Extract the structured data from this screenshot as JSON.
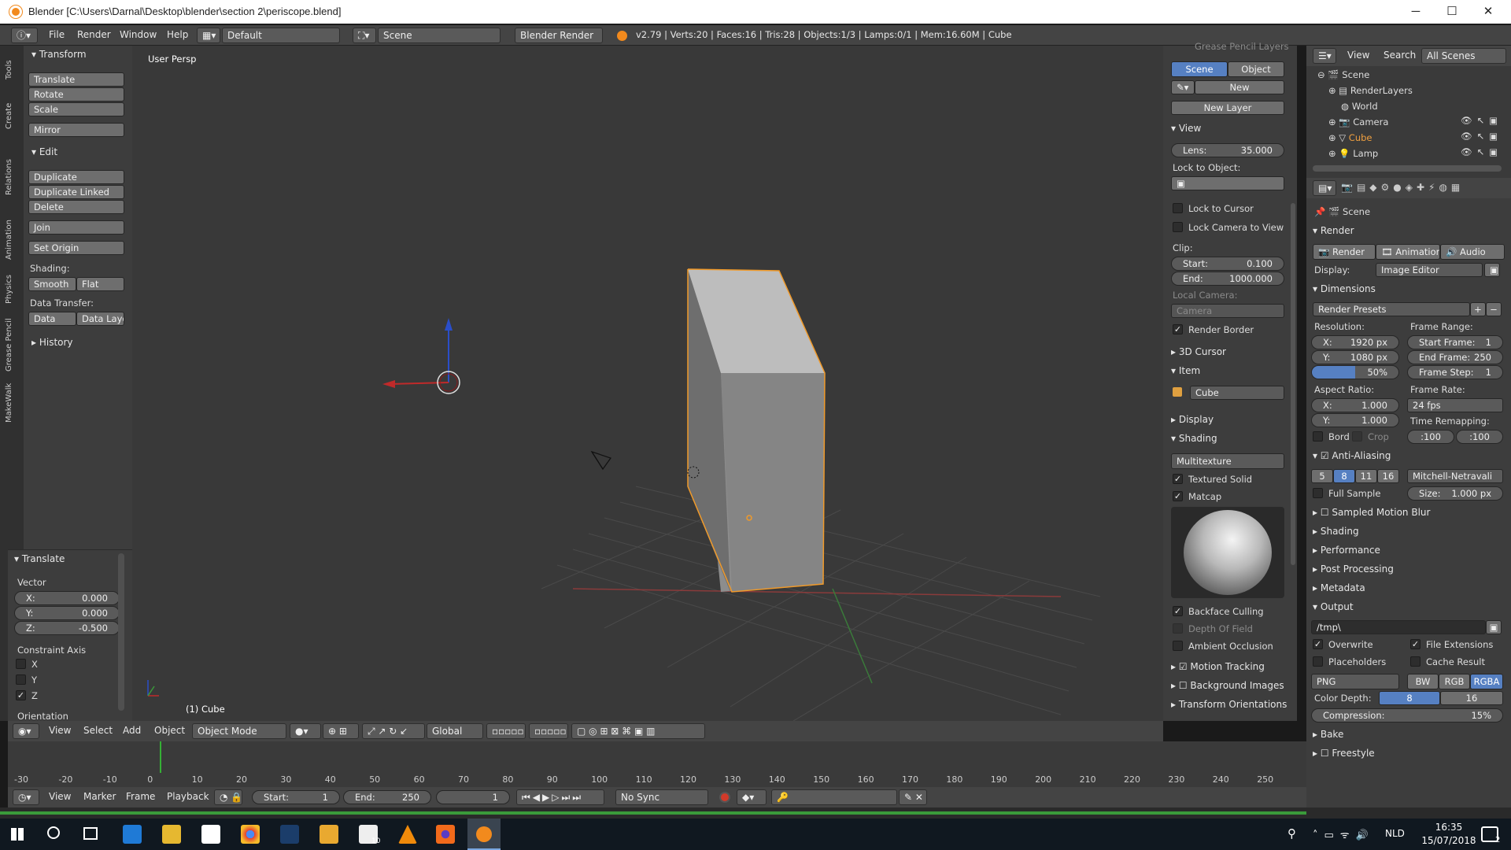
{
  "window": {
    "title": "Blender [C:\\Users\\Darnal\\Desktop\\blender\\section 2\\periscope.blend]",
    "minimize": "─",
    "maximize": "☐",
    "close": "✕"
  },
  "infobar": {
    "menus": [
      "File",
      "Render",
      "Window",
      "Help"
    ],
    "layout": "Default",
    "scene": "Scene",
    "engine": "Blender Render",
    "stats": "v2.79 | Verts:20 | Faces:16 | Tris:28 | Objects:1/3 | Lamps:0/1 | Mem:16.60M | Cube"
  },
  "tools": {
    "tabs": [
      "Tools",
      "Create",
      "Relations",
      "Animation",
      "Physics",
      "Grease Pencil",
      "MakeWalk"
    ],
    "transform_header": "Transform",
    "translate": "Translate",
    "rotate": "Rotate",
    "scale": "Scale",
    "mirror": "Mirror",
    "edit_header": "Edit",
    "duplicate": "Duplicate",
    "duplicate_linked": "Duplicate Linked",
    "delete": "Delete",
    "join": "Join",
    "set_origin": "Set Origin",
    "shading_label": "Shading:",
    "smooth": "Smooth",
    "flat": "Flat",
    "data_transfer_label": "Data Transfer:",
    "data": "Data",
    "data_layout": "Data Layo",
    "history": "History"
  },
  "operator": {
    "header": "Translate",
    "vector_label": "Vector",
    "x_label": "X:",
    "x": "0.000",
    "y_label": "Y:",
    "y": "0.000",
    "z_label": "Z:",
    "z": "-0.500",
    "constraint_label": "Constraint Axis",
    "ax_x": "X",
    "ax_y": "Y",
    "ax_z": "Z",
    "orientation": "Orientation"
  },
  "viewport": {
    "label": "User Persp",
    "object_label": "(1) Cube"
  },
  "view3d_header": {
    "menus": [
      "View",
      "Select",
      "Add",
      "Object"
    ],
    "mode": "Object Mode",
    "orientation": "Global"
  },
  "properties_n": {
    "grease_pencil": "Grease Pencil Layers",
    "scene_tab": "Scene",
    "object_tab": "Object",
    "new": "New",
    "new_layer": "New Layer",
    "view_header": "View",
    "lens_label": "Lens:",
    "lens": "35.000",
    "lock_to_object": "Lock to Object:",
    "lock_to_cursor": "Lock to Cursor",
    "lock_camera": "Lock Camera to View",
    "clip": "Clip:",
    "start_label": "Start:",
    "start": "0.100",
    "end_label": "End:",
    "end": "1000.000",
    "local_camera": "Local Camera:",
    "camera": "Camera",
    "render_border": "Render Border",
    "cursor_header": "3D Cursor",
    "item_header": "Item",
    "item_name": "Cube",
    "display_header": "Display",
    "shading_header": "Shading",
    "multitexture": "Multitexture",
    "textured_solid": "Textured Solid",
    "matcap": "Matcap",
    "backface": "Backface Culling",
    "dof": "Depth Of Field",
    "ao": "Ambient Occlusion",
    "motion_tracking": "Motion Tracking",
    "background_images": "Background Images",
    "transform_orientations": "Transform Orientations"
  },
  "outliner": {
    "view": "View",
    "search": "Search",
    "all_scenes": "All Scenes",
    "items": [
      "Scene",
      "RenderLayers",
      "World",
      "Camera",
      "Cube",
      "Lamp"
    ]
  },
  "render_props": {
    "context": "Scene",
    "render_header": "Render",
    "render_btn": "Render",
    "animation_btn": "Animation",
    "audio_btn": "Audio",
    "display_label": "Display:",
    "display": "Image Editor",
    "dimensions": "Dimensions",
    "presets": "Render Presets",
    "resolution": "Resolution:",
    "res_x_label": "X:",
    "res_x": "1920 px",
    "res_y_label": "Y:",
    "res_y": "1080 px",
    "percent": "50%",
    "frame_range": "Frame Range:",
    "start_frame_label": "Start Frame:",
    "start_frame": "1",
    "end_frame_label": "End Frame:",
    "end_frame": "250",
    "frame_step_label": "Frame Step:",
    "frame_step": "1",
    "aspect": "Aspect Ratio:",
    "asp_x_label": "X:",
    "asp_x": "1.000",
    "asp_y_label": "Y:",
    "asp_y": "1.000",
    "frame_rate": "Frame Rate:",
    "fps": "24 fps",
    "time_remap": "Time Remapping:",
    "remap_old": ":100",
    "remap_new": ":100",
    "bord": "Bord",
    "crop": "Crop",
    "anti_aliasing": "Anti-Aliasing",
    "aa": [
      "5",
      "8",
      "11",
      "16"
    ],
    "filter": "Mitchell-Netravali",
    "full_sample": "Full Sample",
    "size_label": "Size:",
    "size": "1.000 px",
    "smb": "Sampled Motion Blur",
    "shading": "Shading",
    "performance": "Performance",
    "post_processing": "Post Processing",
    "metadata": "Metadata",
    "output": "Output",
    "path": "/tmp\\",
    "overwrite": "Overwrite",
    "file_ext": "File Extensions",
    "placeholders": "Placeholders",
    "cache_result": "Cache Result",
    "format": "PNG",
    "bw": "BW",
    "rgb": "RGB",
    "rgba": "RGBA",
    "color_depth": "Color Depth:",
    "depth8": "8",
    "depth16": "16",
    "compression_label": "Compression:",
    "compression": "15%",
    "bake": "Bake",
    "freestyle": "Freestyle"
  },
  "timeline": {
    "ticks": [
      -30,
      -20,
      -10,
      0,
      10,
      20,
      30,
      40,
      50,
      60,
      70,
      80,
      90,
      100,
      110,
      120,
      130,
      140,
      150,
      160,
      170,
      180,
      190,
      200,
      210,
      220,
      230,
      240,
      250
    ],
    "current_frame": 1,
    "menus": [
      "View",
      "Marker",
      "Frame",
      "Playback"
    ],
    "start_label": "Start:",
    "start": "1",
    "end_label": "End:",
    "end": "250",
    "current": "1",
    "sync": "No Sync"
  },
  "taskbar": {
    "time": "16:35",
    "date": "15/07/2018",
    "lang": "NLD",
    "notif": "2",
    "mail_badge": "10"
  },
  "colors": {
    "selected": "#f09a2a",
    "blue_btn": "#5680c2",
    "viewport": "#393939",
    "panel": "#3d3d3d"
  }
}
